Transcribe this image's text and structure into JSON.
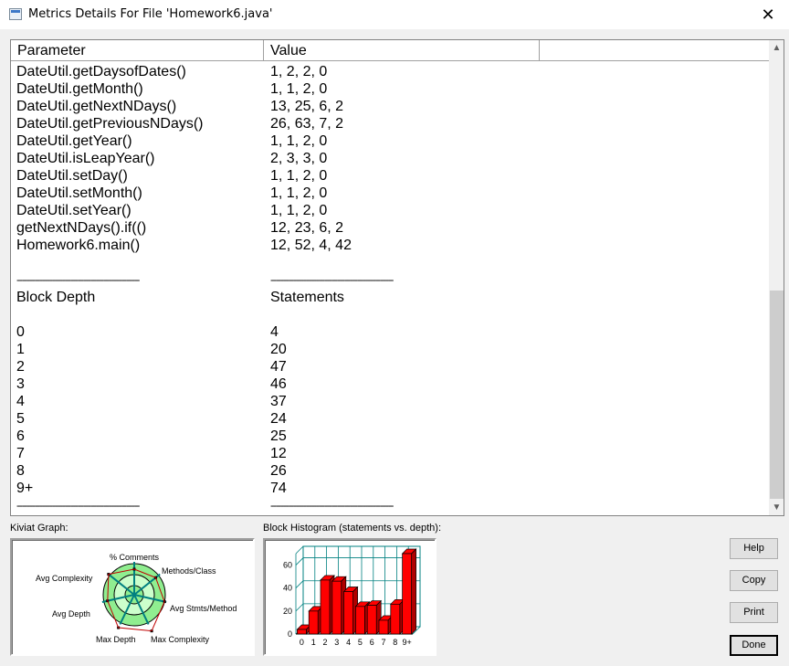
{
  "window": {
    "title": "Metrics Details For File 'Homework6.java'",
    "close_glyph": "✕"
  },
  "table": {
    "columns": [
      "Parameter",
      "Value"
    ],
    "rows": [
      [
        "DateUtil.getDaysofDates()",
        "1, 2, 2, 0"
      ],
      [
        "DateUtil.getMonth()",
        "1, 1, 2, 0"
      ],
      [
        "DateUtil.getNextNDays()",
        "13, 25, 6, 2"
      ],
      [
        "DateUtil.getPreviousNDays()",
        "26, 63, 7, 2"
      ],
      [
        "DateUtil.getYear()",
        "1, 1, 2, 0"
      ],
      [
        "DateUtil.isLeapYear()",
        "2, 3, 3, 0"
      ],
      [
        "DateUtil.setDay()",
        "1, 1, 2, 0"
      ],
      [
        "DateUtil.setMonth()",
        "1, 1, 2, 0"
      ],
      [
        "DateUtil.setYear()",
        "1, 1, 2, 0"
      ],
      [
        "getNextNDays().if(()",
        "12, 23, 6, 2"
      ],
      [
        "Homework6.main()",
        "12, 52, 4, 42"
      ],
      [
        "",
        ""
      ],
      [
        "------------------------------------------------",
        "------------------------------------------------"
      ],
      [
        "Block Depth",
        "Statements"
      ],
      [
        "",
        ""
      ],
      [
        "0",
        "4"
      ],
      [
        "1",
        "20"
      ],
      [
        "2",
        "47"
      ],
      [
        "3",
        "46"
      ],
      [
        "4",
        "37"
      ],
      [
        "5",
        "24"
      ],
      [
        "6",
        "25"
      ],
      [
        "7",
        "12"
      ],
      [
        "8",
        "26"
      ],
      [
        "9+",
        "74"
      ],
      [
        "------------------------------------------------",
        "------------------------------------------------"
      ]
    ]
  },
  "kiviat": {
    "label": "Kiviat Graph:",
    "axes": [
      "% Comments",
      "Methods/Class",
      "Avg Stmts/Method",
      "Max Complexity",
      "Max Depth",
      "Avg Depth",
      "Avg Complexity"
    ],
    "colors": {
      "outer_ring": "#90ee90",
      "inner_ring": "#ccffcc",
      "spokes": "#008080",
      "polygon": "#c00000"
    }
  },
  "histogram": {
    "label": "Block Histogram (statements vs. depth):",
    "categories": [
      "0",
      "1",
      "2",
      "3",
      "4",
      "5",
      "6",
      "7",
      "8",
      "9+"
    ],
    "values": [
      4,
      20,
      47,
      46,
      37,
      24,
      25,
      12,
      26,
      74
    ],
    "y_ticks": [
      "0",
      "20",
      "40",
      "60"
    ],
    "ylim": [
      0,
      70
    ],
    "bar_color": "#ff0000",
    "grid_color": "#008080"
  },
  "buttons": {
    "help": "Help",
    "copy": "Copy",
    "print": "Print",
    "done": "Done"
  }
}
